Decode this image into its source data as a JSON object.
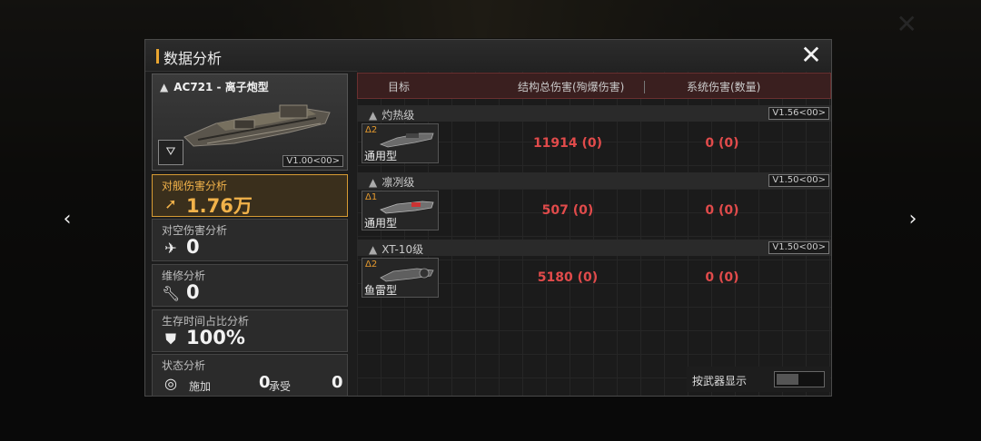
{
  "panel": {
    "title": "数据分析"
  },
  "ship": {
    "name": "AC721 - 离子炮型",
    "version": "V1.00<00>"
  },
  "stats": [
    {
      "label": "对舰伤害分析",
      "value": "1.76万"
    },
    {
      "label": "对空伤害分析",
      "value": "0"
    },
    {
      "label": "维修分析",
      "value": "0"
    },
    {
      "label": "生存时间占比分析",
      "value": "100%"
    }
  ],
  "status": {
    "label": "状态分析",
    "apply_label": "施加",
    "apply_value": "0",
    "take_label": "承受",
    "take_value": "0"
  },
  "table": {
    "headers": [
      "目标",
      "结构总伤害(殉爆伤害)",
      "系统伤害(数量)"
    ],
    "groups": [
      {
        "name": "灼热级",
        "version": "V1.56<00>",
        "weapon_level": "Δ2",
        "weapon_type": "通用型",
        "structure_damage": "11914 (0)",
        "system_damage": "0 (0)"
      },
      {
        "name": "凛冽级",
        "version": "V1.50<00>",
        "weapon_level": "Δ1",
        "weapon_type": "通用型",
        "structure_damage": "507 (0)",
        "system_damage": "0 (0)"
      },
      {
        "name": "XT-10级",
        "version": "V1.50<00>",
        "weapon_level": "Δ2",
        "weapon_type": "鱼雷型",
        "structure_damage": "5180 (0)",
        "system_damage": "0 (0)"
      }
    ]
  },
  "toggle": {
    "label": "按武器显示",
    "on": false
  },
  "colors": {
    "accent": "#f1b24a",
    "damage": "#e14b4b",
    "header_bg": "#3a1f1f"
  },
  "icons": {
    "close": "close-icon",
    "prev": "chevron-left-icon",
    "next": "chevron-right-icon",
    "anti_ship": "anti-ship-icon",
    "anti_air": "anti-air-icon",
    "repair": "wrench-icon",
    "survival": "shield-icon",
    "status": "pulse-icon"
  }
}
